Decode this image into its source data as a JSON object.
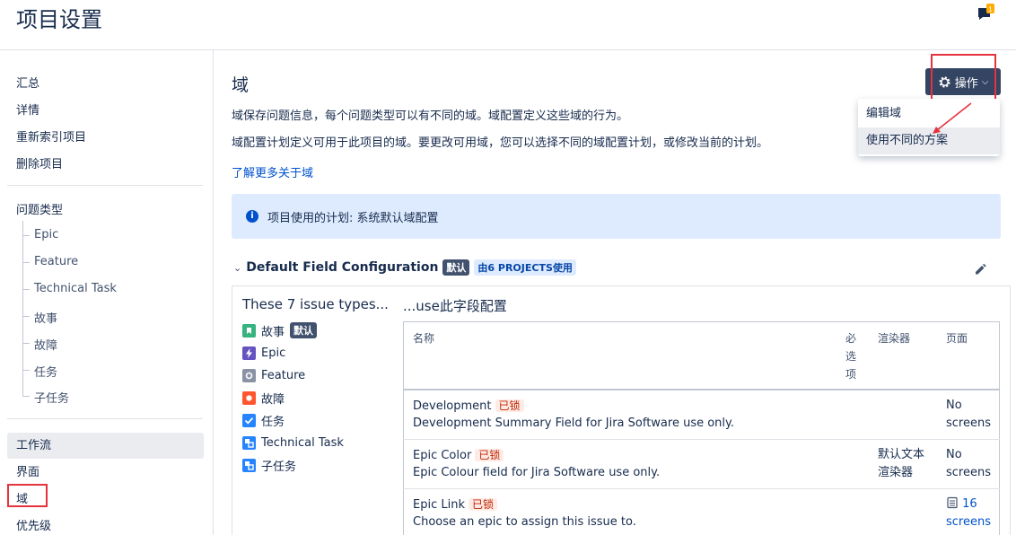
{
  "header": {
    "title": "项目设置",
    "notification_count": "1"
  },
  "sidebar": {
    "top_items": [
      {
        "label": "汇总"
      },
      {
        "label": "详情"
      },
      {
        "label": "重新索引项目"
      },
      {
        "label": "删除项目"
      }
    ],
    "issue_types_label": "问题类型",
    "issue_types": [
      {
        "label": "Epic"
      },
      {
        "label": "Feature"
      },
      {
        "label": "Technical Task"
      },
      {
        "label": "故事"
      },
      {
        "label": "故障"
      },
      {
        "label": "任务"
      },
      {
        "label": "子任务"
      }
    ],
    "bottom_items": [
      {
        "label": "工作流"
      },
      {
        "label": "界面"
      },
      {
        "label": "域"
      },
      {
        "label": "优先级"
      }
    ]
  },
  "main": {
    "title": "域",
    "desc1": "域保存问题信息，每个问题类型可以有不同的域。域配置定义这些域的行为。",
    "desc2": "域配置计划定义可用于此项目的域。要更改可用域，您可以选择不同的域配置计划，或修改当前的计划。",
    "learn_more": "了解更多关于域",
    "actions_button": "操作",
    "actions_menu": [
      {
        "label": "编辑域"
      },
      {
        "label": "使用不同的方案"
      }
    ],
    "info_text": "项目使用的计划: 系统默认域配置"
  },
  "config": {
    "name": "Default Field Configuration",
    "default_badge": "默认",
    "projects_badge": "由6 PROJECTS使用",
    "left_title": "These 7 issue types...",
    "right_title": "...use此字段配置",
    "issue_types": [
      {
        "label": "故事",
        "icon": "story-icon",
        "color": "#36b37e",
        "badge": "默认"
      },
      {
        "label": "Epic",
        "icon": "epic-icon",
        "color": "#6554c0",
        "badge": ""
      },
      {
        "label": "Feature",
        "icon": "feature-icon",
        "color": "#8993a4",
        "badge": ""
      },
      {
        "label": "故障",
        "icon": "bug-icon",
        "color": "#ff5630",
        "badge": ""
      },
      {
        "label": "任务",
        "icon": "task-icon",
        "color": "#2684ff",
        "badge": ""
      },
      {
        "label": "Technical Task",
        "icon": "subtask-icon",
        "color": "#2684ff",
        "badge": ""
      },
      {
        "label": "子任务",
        "icon": "subtask-icon",
        "color": "#2684ff",
        "badge": ""
      }
    ],
    "table": {
      "headers": {
        "name": "名称",
        "required": "必\n选\n项",
        "renderer": "渲染器",
        "screens": "页面"
      },
      "locked_label": "已锁",
      "rows": [
        {
          "name": "Development",
          "desc": "Development Summary Field for Jira Software use only.",
          "renderer": "",
          "screens1": "No",
          "screens2": "screens"
        },
        {
          "name": "Epic Color",
          "desc": "Epic Colour field for Jira Software use only.",
          "renderer": "默认文本\n渲染器",
          "screens1": "No",
          "screens2": "screens"
        },
        {
          "name": "Epic Link",
          "desc": "Choose an epic to assign this issue to.",
          "renderer": "",
          "screens1": "16",
          "screens2": "screens"
        }
      ]
    }
  },
  "colors": {
    "accent": "#0052cc",
    "button": "#344563",
    "highlight_box": "#e5333d"
  }
}
